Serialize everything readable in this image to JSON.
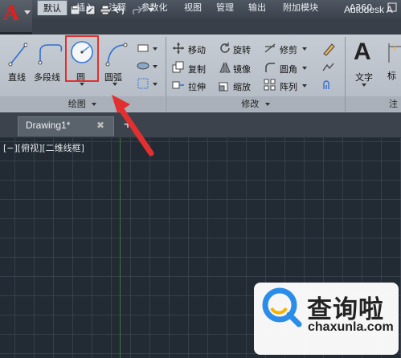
{
  "title_bar": {
    "title": "Autodesk A"
  },
  "quick_access": [
    "new-icon",
    "open-icon",
    "save-icon",
    "save-as-icon",
    "print-icon",
    "undo-icon",
    "redo-icon",
    "dropdown-icon"
  ],
  "ribbon_tabs": [
    {
      "label": "默认",
      "active": true
    },
    {
      "label": "插入",
      "active": false
    },
    {
      "label": "注释",
      "active": false
    },
    {
      "label": "参数化",
      "active": false
    },
    {
      "label": "视图",
      "active": false
    },
    {
      "label": "管理",
      "active": false
    },
    {
      "label": "输出",
      "active": false
    },
    {
      "label": "附加模块",
      "active": false
    },
    {
      "label": "A360",
      "active": false
    }
  ],
  "draw_panel": {
    "title": "绘图",
    "tools": {
      "line": "直线",
      "polyline": "多段线",
      "circle": "圆",
      "arc": "圆弧"
    }
  },
  "modify_panel": {
    "title": "修改",
    "tools": {
      "move": "移动",
      "rotate": "旋转",
      "trim": "修剪",
      "copy": "复制",
      "mirror": "镜像",
      "fillet": "圆角",
      "stretch": "拉伸",
      "scale": "缩放",
      "array": "阵列"
    }
  },
  "annotation_panel": {
    "text": "文字",
    "dimension": "标",
    "partial_title": "注"
  },
  "document_tab": {
    "label": "Drawing1*",
    "close": "✖",
    "new_tab": "+"
  },
  "viewport": {
    "label": "[−][俯视][二维线框]"
  },
  "watermark": {
    "title": "查询啦",
    "url": "chaxunla.com"
  },
  "colors": {
    "accent_red": "#e03030",
    "canvas_bg": "#222a33",
    "ribbon_bg": "#c6ccd4"
  }
}
